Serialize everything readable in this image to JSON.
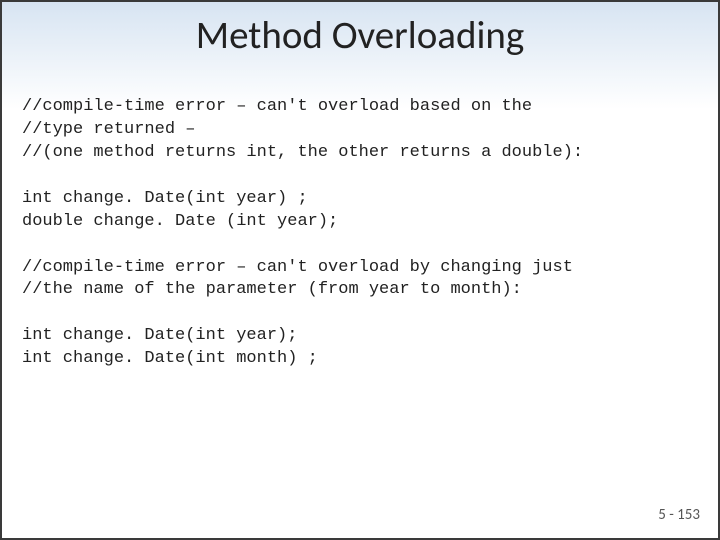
{
  "title": "Method Overloading",
  "code": {
    "l1": "//compile-time error – can't overload based on the",
    "l2": "//type returned –",
    "l3": "//(one method returns int, the other returns a double):",
    "l4": "",
    "l5": "int change. Date(int year) ;",
    "l6": "double change. Date (int year);",
    "l7": "",
    "l8": "//compile-time error – can't overload by changing just",
    "l9": "//the name of the parameter (from year to month):",
    "l10": "",
    "l11": "int change. Date(int year);",
    "l12": "int change. Date(int month) ;"
  },
  "page_number": "5 - 153"
}
